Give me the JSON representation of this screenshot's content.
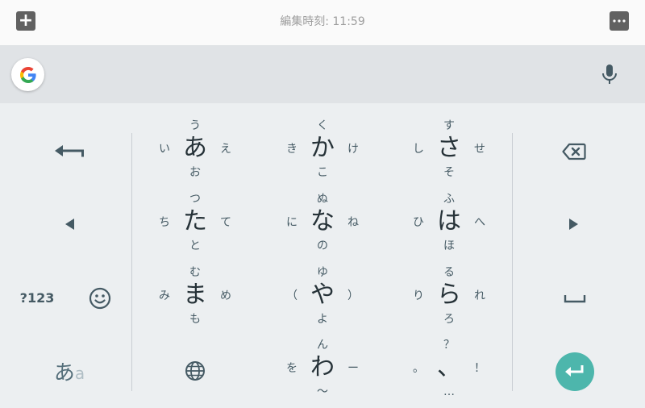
{
  "topbar": {
    "title": "編集時刻: 11:59",
    "plus_icon": "plus-icon",
    "more_icon": "more-dots-icon"
  },
  "suggest": {
    "logo": "google-logo",
    "mic_icon": "mic-icon"
  },
  "keys": [
    {
      "main": "あ",
      "up": "う",
      "left": "い",
      "right": "え",
      "down": "お"
    },
    {
      "main": "か",
      "up": "く",
      "left": "き",
      "right": "け",
      "down": "こ"
    },
    {
      "main": "さ",
      "up": "す",
      "left": "し",
      "right": "せ",
      "down": "そ"
    },
    {
      "main": "た",
      "up": "つ",
      "left": "ち",
      "right": "て",
      "down": "と"
    },
    {
      "main": "な",
      "up": "ぬ",
      "left": "に",
      "right": "ね",
      "down": "の"
    },
    {
      "main": "は",
      "up": "ふ",
      "left": "ひ",
      "right": "へ",
      "down": "ほ"
    },
    {
      "main": "ま",
      "up": "む",
      "left": "み",
      "right": "め",
      "down": "も"
    },
    {
      "main": "や",
      "up": "ゆ",
      "left": "（",
      "right": "）",
      "down": "よ"
    },
    {
      "main": "ら",
      "up": "る",
      "left": "り",
      "right": "れ",
      "down": "ろ"
    },
    {
      "main": "わ",
      "up": "ん",
      "left": "を",
      "right": "ー",
      "down": "〜"
    },
    {
      "main": "、",
      "up": "？",
      "left": "。",
      "right": "！",
      "down": "…"
    }
  ],
  "side": {
    "symbols_label": "?123",
    "mode_main": "あ",
    "mode_sub": "a",
    "undo_icon": "undo-arrow-icon",
    "left_icon": "cursor-left-icon",
    "right_icon": "cursor-right-icon",
    "emoji_icon": "emoji-icon",
    "globe_icon": "globe-icon",
    "backspace_icon": "backspace-icon",
    "space_icon": "space-icon",
    "enter_icon": "enter-icon"
  },
  "colors": {
    "accent": "#4db6ac",
    "keyboard_bg": "#eceff1",
    "suggest_bg": "#e0e3e6",
    "topbar_bg": "#fafafa"
  }
}
